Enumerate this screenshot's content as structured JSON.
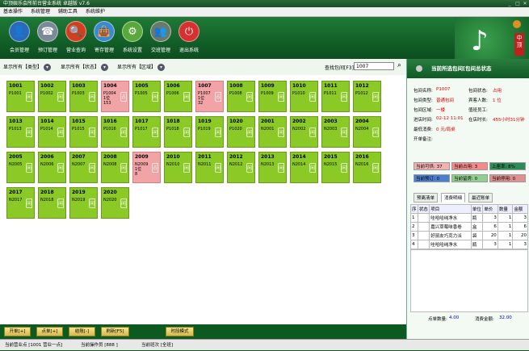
{
  "window": {
    "title": "中顶娱乐会所前台营业系统 卓越版 v7.6",
    "minimize": "_",
    "maximize": "□",
    "close": "✕"
  },
  "menu": [
    "基本操作",
    "系统管理",
    "辅助工具",
    "系统维护"
  ],
  "toolbar": [
    {
      "label": "会员管理",
      "icon": "member-icon",
      "glyph": "👤"
    },
    {
      "label": "预订管理",
      "icon": "phone-icon",
      "glyph": "☎"
    },
    {
      "label": "营业查询",
      "icon": "magnifier-icon",
      "glyph": "🔍"
    },
    {
      "label": "寄存管理",
      "icon": "bag-icon",
      "glyph": "👜"
    },
    {
      "label": "系统设置",
      "icon": "gear-icon",
      "glyph": "⚙"
    },
    {
      "label": "交班管理",
      "icon": "team-icon",
      "glyph": "👥"
    },
    {
      "label": "退出系统",
      "icon": "power-icon",
      "glyph": "⏻"
    }
  ],
  "logo": {
    "seal_text": "中顶"
  },
  "filters": {
    "type": "显示所有【类型】",
    "status": "显示所有【状态】",
    "zone": "显示所有【区域】",
    "search_label": "查找包间[F3]",
    "search_value": "1007"
  },
  "rooms": [
    {
      "no": "1001",
      "name": "P1001",
      "extra": [],
      "occupied": false
    },
    {
      "no": "1002",
      "name": "P1002",
      "extra": [],
      "occupied": false
    },
    {
      "no": "1003",
      "name": "P1003",
      "extra": [],
      "occupied": false
    },
    {
      "no": "1004",
      "name": "P1004",
      "extra": [
        "1位",
        "153"
      ],
      "occupied": true
    },
    {
      "no": "1005",
      "name": "P1005",
      "extra": [],
      "occupied": false
    },
    {
      "no": "1006",
      "name": "P1006",
      "extra": [],
      "occupied": false
    },
    {
      "no": "1007",
      "name": "P1007",
      "extra": [
        "1位",
        "32"
      ],
      "occupied": true
    },
    {
      "no": "1008",
      "name": "P1008",
      "extra": [],
      "occupied": false
    },
    {
      "no": "1009",
      "name": "P1009",
      "extra": [],
      "occupied": false
    },
    {
      "no": "1010",
      "name": "P1010",
      "extra": [],
      "occupied": false
    },
    {
      "no": "1011",
      "name": "P1011",
      "extra": [],
      "occupied": false
    },
    {
      "no": "1012",
      "name": "P1012",
      "extra": [],
      "occupied": false
    },
    {
      "no": "1013",
      "name": "P1013",
      "extra": [],
      "occupied": false
    },
    {
      "no": "1014",
      "name": "P1014",
      "extra": [],
      "occupied": false
    },
    {
      "no": "1015",
      "name": "P1015",
      "extra": [],
      "occupied": false
    },
    {
      "no": "1016",
      "name": "P1016",
      "extra": [],
      "occupied": false
    },
    {
      "no": "1017",
      "name": "P1017",
      "extra": [],
      "occupied": false
    },
    {
      "no": "1018",
      "name": "P1018",
      "extra": [],
      "occupied": false
    },
    {
      "no": "1019",
      "name": "P1019",
      "extra": [],
      "occupied": false
    },
    {
      "no": "1020",
      "name": "P1020",
      "extra": [],
      "occupied": false
    },
    {
      "no": "2001",
      "name": "N2001",
      "extra": [],
      "occupied": false
    },
    {
      "no": "2002",
      "name": "N2002",
      "extra": [],
      "occupied": false
    },
    {
      "no": "2003",
      "name": "N2003",
      "extra": [],
      "occupied": false
    },
    {
      "no": "2004",
      "name": "N2004",
      "extra": [],
      "occupied": false
    },
    {
      "no": "2005",
      "name": "N2005",
      "extra": [],
      "occupied": false
    },
    {
      "no": "2006",
      "name": "N2006",
      "extra": [],
      "occupied": false
    },
    {
      "no": "2007",
      "name": "N2007",
      "extra": [],
      "occupied": false
    },
    {
      "no": "2008",
      "name": "N2008",
      "extra": [],
      "occupied": false
    },
    {
      "no": "2009",
      "name": "N2009",
      "extra": [
        "1位",
        "8"
      ],
      "occupied": true
    },
    {
      "no": "2010",
      "name": "N2010",
      "extra": [],
      "occupied": false
    },
    {
      "no": "2011",
      "name": "N2011",
      "extra": [],
      "occupied": false
    },
    {
      "no": "2012",
      "name": "N2012",
      "extra": [],
      "occupied": false
    },
    {
      "no": "2013",
      "name": "N2013",
      "extra": [],
      "occupied": false
    },
    {
      "no": "2014",
      "name": "N2014",
      "extra": [],
      "occupied": false
    },
    {
      "no": "2015",
      "name": "N2015",
      "extra": [],
      "occupied": false
    },
    {
      "no": "2016",
      "name": "N2016",
      "extra": [],
      "occupied": false
    },
    {
      "no": "2017",
      "name": "N2017",
      "extra": [],
      "occupied": false
    },
    {
      "no": "2018",
      "name": "N2018",
      "extra": [],
      "occupied": false
    },
    {
      "no": "2019",
      "name": "N2019",
      "extra": [],
      "occupied": false
    },
    {
      "no": "2020",
      "name": "N2020",
      "extra": [],
      "occupied": false
    }
  ],
  "badge": {
    "occupied": "占",
    "free": "闲"
  },
  "bottom_buttons": [
    "开单[+]",
    "点单[+]",
    "结账[-]",
    "刷新[F5]",
    "时段模式"
  ],
  "status_bar": {
    "shop": "当前营业点 [1001 营业一点]",
    "operator": "当前操作员 [888 ]",
    "shift": "当前班次 [全班]"
  },
  "panel": {
    "title": "当前所选包间[包间总状态",
    "fields": [
      {
        "k": "包间名称:",
        "v": "P1007",
        "k2": "包间状态:",
        "v2": "占用"
      },
      {
        "k": "包间类型:",
        "v": "普通包间",
        "k2": "宾客人数:",
        "v2": "1 位"
      },
      {
        "k": "包间区域:",
        "v": "一楼",
        "k2": "值班员工:",
        "v2": ""
      },
      {
        "k": "进店时间:",
        "v": "02-12 11:01",
        "k2": "在店时长:",
        "v2": "455小时31分钟"
      },
      {
        "k": "最低消费:",
        "v": "0 元/局桌",
        "k2": "",
        "v2": ""
      },
      {
        "k": "开单备注:",
        "v": "",
        "k2": "",
        "v2": ""
      }
    ],
    "tiles": [
      {
        "label": "当前可供: 37",
        "color": "#f2b2b2"
      },
      {
        "label": "当前占用: 3",
        "color": "#f58a8a"
      },
      {
        "label": "上座率: 8%",
        "color": "#2e8b57"
      },
      {
        "label": "当前预订: 0",
        "color": "#4c7fd0"
      },
      {
        "label": "当前留房: 0",
        "color": "#8fd08f"
      },
      {
        "label": "当前停用: 0",
        "color": "#e09090"
      }
    ],
    "tabs": [
      "预离清单",
      "消费明细",
      "最近账单"
    ],
    "columns": [
      "序",
      "状态",
      "项目",
      "单位",
      "单价",
      "数量",
      "金额"
    ],
    "rows": [
      [
        "1",
        "",
        "哇哈哈纯净水",
        "瓶",
        "3",
        "1",
        "3"
      ],
      [
        "2",
        "",
        "嘉兴草莓味香卷",
        "盒",
        "6",
        "1",
        "6"
      ],
      [
        "3",
        "",
        "好丽友巧克力派",
        "袋",
        "20",
        "1",
        "20"
      ],
      [
        "4",
        "",
        "哇哈哈纯净水",
        "瓶",
        "3",
        "1",
        "3"
      ]
    ],
    "totals": {
      "qty_label": "点单数量:",
      "qty": "4.00",
      "amount_label": "消费金额:",
      "amount": "32.00"
    }
  }
}
